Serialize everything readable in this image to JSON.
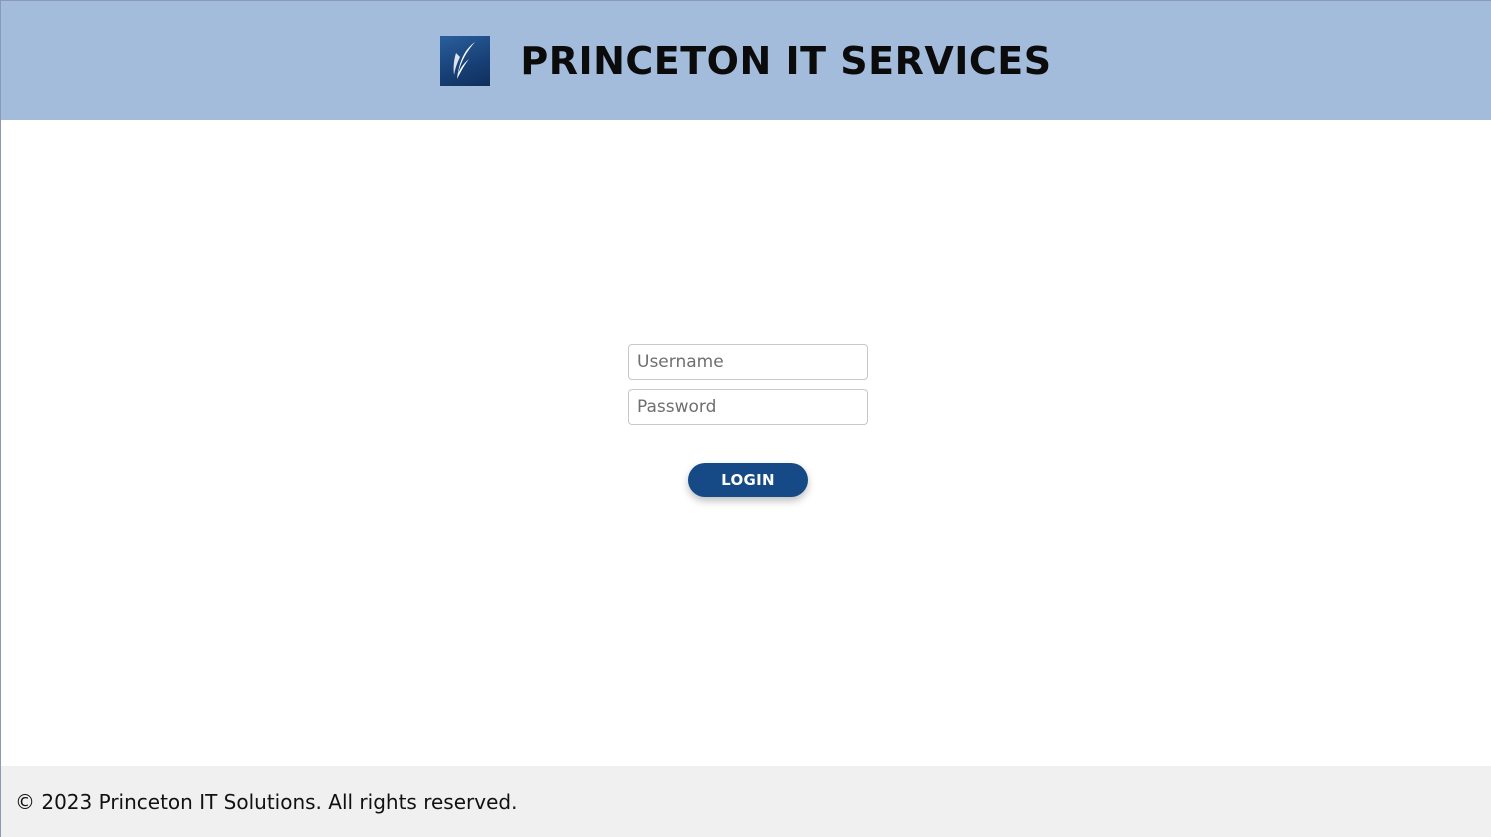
{
  "header": {
    "logo_icon": "feather-quill-icon",
    "title": "PRINCETON IT SERVICES",
    "background_color": "#a3bcdc"
  },
  "login_form": {
    "username_placeholder": "Username",
    "username_value": "",
    "password_placeholder": "Password",
    "password_value": "",
    "login_label": "LOGIN",
    "button_color": "#154a86"
  },
  "footer": {
    "text": "© 2023 Princeton IT Solutions. All rights reserved."
  }
}
